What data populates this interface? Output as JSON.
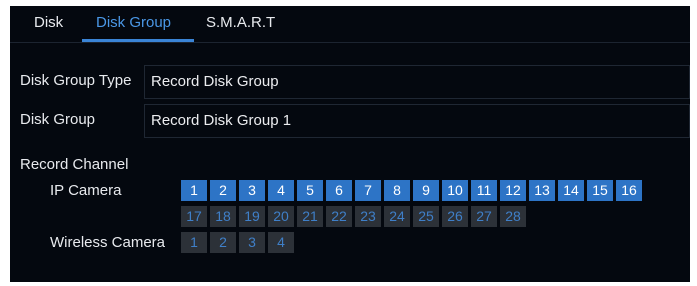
{
  "tabs": [
    {
      "label": "Disk",
      "active": false
    },
    {
      "label": "Disk Group",
      "active": true
    },
    {
      "label": "S.M.A.R.T",
      "active": false
    }
  ],
  "form": {
    "disk_group_type_label": "Disk Group Type",
    "disk_group_type_value": "Record Disk Group",
    "disk_group_label": "Disk Group",
    "disk_group_value": "Record Disk Group 1"
  },
  "record_channel": {
    "label": "Record Channel",
    "ip_camera_label": "IP Camera",
    "ip_camera_row1": [
      "1",
      "2",
      "3",
      "4",
      "5",
      "6",
      "7",
      "8",
      "9",
      "10",
      "11",
      "12",
      "13",
      "14",
      "15",
      "16"
    ],
    "ip_camera_row2": [
      "17",
      "18",
      "19",
      "20",
      "21",
      "22",
      "23",
      "24",
      "25",
      "26",
      "27",
      "28"
    ],
    "wireless_camera_label": "Wireless Camera",
    "wireless_camera": [
      "1",
      "2",
      "3",
      "4"
    ]
  },
  "colors": {
    "background": "#04080f",
    "accent": "#3a84d6",
    "channel_selected": "#2d74c6",
    "channel_unselected": "#2c3138"
  }
}
